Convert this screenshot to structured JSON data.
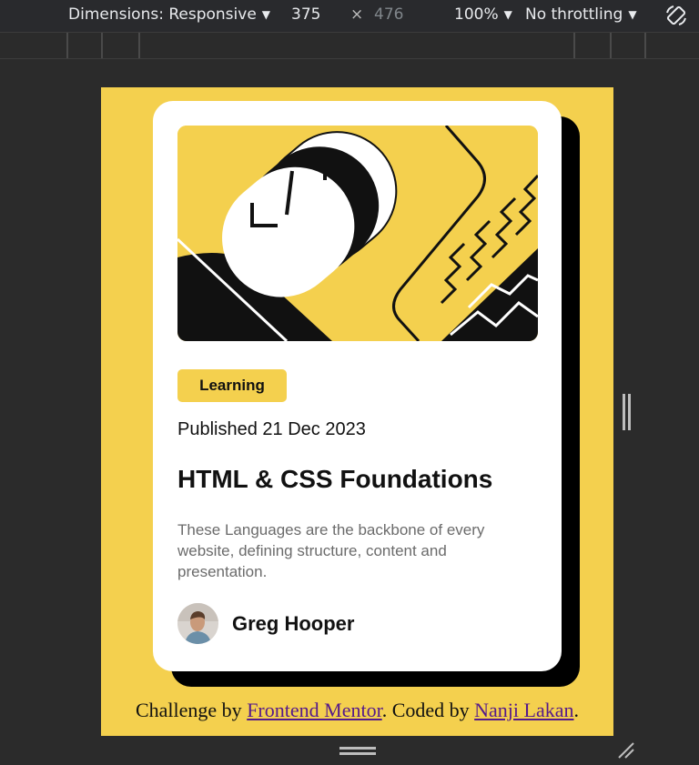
{
  "devtools": {
    "dimensions_label": "Dimensions: Responsive",
    "width": "375",
    "separator": "×",
    "height": "476",
    "zoom": "100%",
    "throttling": "No throttling",
    "rotate_icon": "rotate-icon"
  },
  "card": {
    "tag": "Learning",
    "published": "Published 21 Dec 2023",
    "title": "HTML & CSS Foundations",
    "description": "These Languages are the backbone of every website, defining structure, content and presentation.",
    "author": "Greg Hooper"
  },
  "footer": {
    "prefix": "Challenge by ",
    "link1": "Frontend Mentor",
    "middle": ". Coded by ",
    "link2": "Nanji Lakan",
    "suffix": "."
  },
  "colors": {
    "accent_yellow": "#f4d04e",
    "link_visited": "#551a8b",
    "muted_text": "#6b6b6b"
  }
}
